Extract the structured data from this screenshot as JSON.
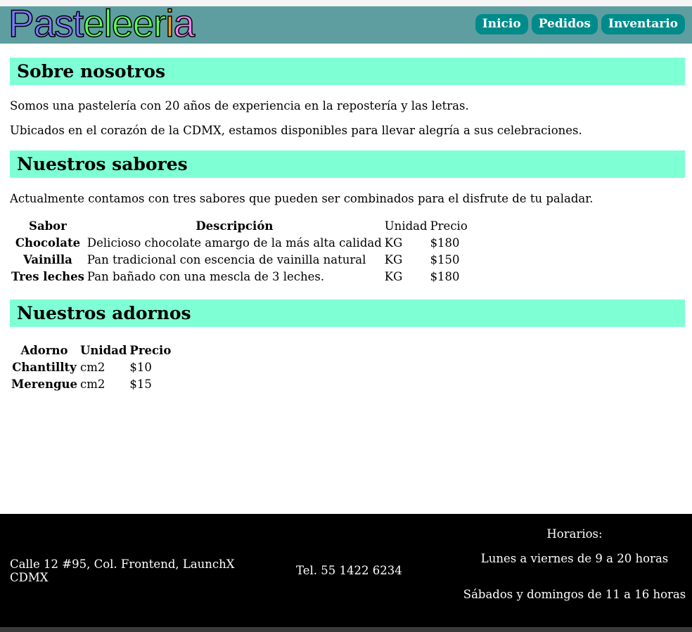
{
  "header": {
    "logo_letters": [
      "P",
      "a",
      "s",
      "t",
      "e",
      "l",
      "e",
      "e",
      "r",
      "i",
      "a"
    ],
    "logo_text": "Pasteleeria",
    "nav": [
      "Inicio",
      "Pedidos",
      "Inventario"
    ]
  },
  "about": {
    "title": "Sobre nosotros",
    "p1": "Somos una pastelería con 20 años de experiencia en la repostería y las letras.",
    "p2": "Ubicados en el corazón de la CDMX, estamos disponibles para llevar alegría a sus celebraciones."
  },
  "flavors": {
    "title": "Nuestros sabores",
    "intro": "Actualmente contamos con tres sabores que pueden ser combinados para el disfrute de tu paladar.",
    "headers": [
      "Sabor",
      "Descripción",
      "Unidad",
      "Precio"
    ],
    "rows": [
      {
        "name": "Chocolate",
        "desc": "Delicioso chocolate amargo de la más alta calidad",
        "unit": "KG",
        "price": "$180"
      },
      {
        "name": "Vainilla",
        "desc": "Pan tradicional con escencia de vainilla natural",
        "unit": "KG",
        "price": "$150"
      },
      {
        "name": "Tres leches",
        "desc": "Pan bañado con una mescla de 3 leches.",
        "unit": "KG",
        "price": "$180"
      }
    ]
  },
  "toppings": {
    "title": "Nuestros adornos",
    "headers": [
      "Adorno",
      "Unidad",
      "Precio"
    ],
    "rows": [
      {
        "name": "Chantillty",
        "unit": "cm2",
        "price": "$10"
      },
      {
        "name": "Merengue",
        "unit": "cm2",
        "price": "$15"
      }
    ]
  },
  "footer": {
    "address": "Calle 12 #95, Col. Frontend, LaunchX CDMX",
    "phone": "Tel. 55 1422 6234",
    "hours_title": "Horarios:",
    "hours_weekdays": "Lunes a viernes de 9 a 20 horas",
    "hours_weekend": "Sábados y domingos de 11 a 16 horas"
  },
  "colors": {
    "header_bg": "#5f9ea0",
    "nav_bg": "#008b8b",
    "section_bg": "#7fffd4",
    "footer_bg": "#000000",
    "logo_colors": [
      "#7b7bff",
      "#7b7bff",
      "#7b7bff",
      "#7b7bff",
      "#5aff5a",
      "#5aff5a",
      "#5aff5a",
      "#5aff5a",
      "#5aff5a",
      "#ffa500",
      "#ee82ee"
    ]
  }
}
